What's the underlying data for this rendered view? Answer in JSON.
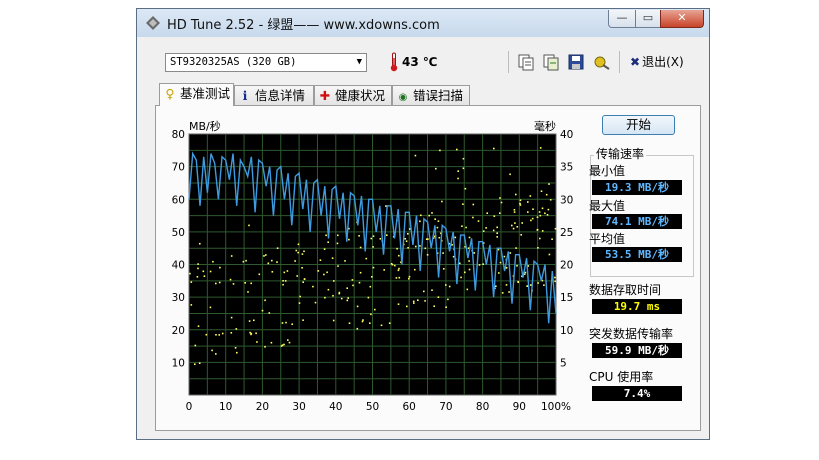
{
  "window": {
    "title": "HD Tune 2.52 - 绿盟—— www.xdowns.com",
    "min_glyph": "—",
    "max_glyph": "▭",
    "close_glyph": "✕"
  },
  "toolbar": {
    "drive": "ST9320325AS (320 GB)",
    "temperature": "43 ℃",
    "exit_label": "退出(X)"
  },
  "tabs": [
    {
      "label": "基准测试",
      "icon": "benchmark-icon",
      "glyph": "♀"
    },
    {
      "label": "信息详情",
      "icon": "info-icon",
      "glyph": "ℹ"
    },
    {
      "label": "健康状况",
      "icon": "health-cross-icon",
      "glyph": "✚"
    },
    {
      "label": "错误扫描",
      "icon": "magnifier-icon",
      "glyph": "🔍"
    }
  ],
  "panel": {
    "start_button": "开始",
    "transfer_rate": {
      "title": "传输速率",
      "min_label": "最小值",
      "min_value": "19.3 MB/秒",
      "max_label": "最大值",
      "max_value": "74.1 MB/秒",
      "avg_label": "平均值",
      "avg_value": "53.5 MB/秒"
    },
    "access_time_label": "数据存取时间",
    "access_time_value": "19.7 ms",
    "burst_label": "突发数据传输率",
    "burst_value": "59.9 MB/秒",
    "cpu_label": "CPU 使用率",
    "cpu_value": "7.4%"
  },
  "colors": {
    "transfer_line": "#3f9be0",
    "access_dots": "#ffff66",
    "grid": "#2e5a2e",
    "plot_bg": "#000000"
  },
  "chart_data": {
    "type": "line",
    "y_left_label": "MB/秒",
    "y_right_label": "毫秒",
    "y_left_range": [
      0,
      80
    ],
    "y_right_range": [
      0,
      40
    ],
    "x_range": [
      0,
      100
    ],
    "x_ticks": [
      "0",
      "10",
      "20",
      "30",
      "40",
      "50",
      "60",
      "70",
      "80",
      "90",
      "100%"
    ],
    "y_left_ticks": [
      "10",
      "20",
      "30",
      "40",
      "50",
      "60",
      "70",
      "80"
    ],
    "y_right_ticks": [
      "5",
      "10",
      "15",
      "20",
      "25",
      "30",
      "35",
      "40"
    ],
    "grid": true,
    "series": [
      {
        "name": "",
        "x": [
          0,
          1,
          2,
          3,
          4,
          5,
          6,
          7,
          8,
          9,
          10,
          11,
          12,
          13,
          14,
          15,
          16,
          17,
          18,
          19,
          20,
          21,
          22,
          23,
          24,
          25,
          26,
          27,
          28,
          29,
          30,
          31,
          32,
          33,
          34,
          35,
          36,
          37,
          38,
          39,
          40,
          41,
          42,
          43,
          44,
          45,
          46,
          47,
          48,
          49,
          50,
          51,
          52,
          53,
          54,
          55,
          56,
          57,
          58,
          59,
          60,
          61,
          62,
          63,
          64,
          65,
          66,
          67,
          68,
          69,
          70,
          71,
          72,
          73,
          74,
          75,
          76,
          77,
          78,
          79,
          80,
          81,
          82,
          83,
          84,
          85,
          86,
          87,
          88,
          89,
          90,
          91,
          92,
          93,
          94,
          95,
          96,
          97,
          98,
          99,
          100
        ],
        "values": [
          60,
          74,
          72,
          58,
          73,
          62,
          74,
          71,
          60,
          73,
          72,
          66,
          74,
          58,
          72,
          70,
          67,
          73,
          56,
          72,
          71,
          64,
          70,
          55,
          69,
          70,
          60,
          68,
          52,
          67,
          68,
          57,
          66,
          50,
          65,
          66,
          55,
          64,
          48,
          63,
          64,
          54,
          62,
          47,
          62,
          61,
          52,
          61,
          44,
          60,
          60,
          50,
          58,
          43,
          58,
          58,
          48,
          57,
          40,
          56,
          56,
          46,
          55,
          38,
          54,
          53,
          45,
          52,
          36,
          52,
          51,
          44,
          50,
          34,
          49,
          49,
          42,
          48,
          32,
          47,
          47,
          40,
          46,
          30,
          45,
          45,
          38,
          44,
          28,
          43,
          43,
          36,
          42,
          26,
          41,
          40,
          35,
          40,
          22,
          38,
          25
        ]
      }
    ]
  }
}
